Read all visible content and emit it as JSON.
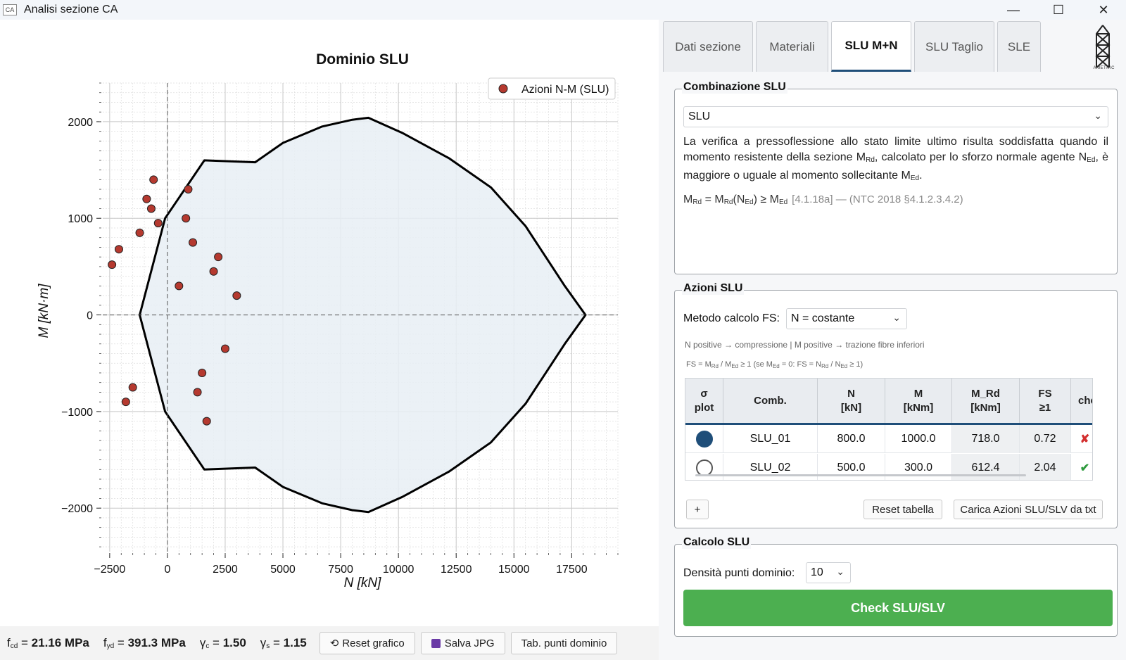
{
  "window": {
    "title": "Analisi sezione CA",
    "icon_label": "CA"
  },
  "plot": {
    "title": "Dominio SLU"
  },
  "chart_data": {
    "type": "scatter",
    "title": "Dominio SLU",
    "xlabel": "N [kN]",
    "ylabel": "M [kN·m]",
    "xlim": [
      -2800,
      19500
    ],
    "ylim": [
      -2450,
      2400
    ],
    "xticks": [
      -2500,
      0,
      2500,
      5000,
      7500,
      10000,
      12500,
      15000,
      17500
    ],
    "yticks": [
      -2000,
      -1000,
      0,
      1000,
      2000
    ],
    "grid": true,
    "legend": "top-right",
    "domain_boundary": [
      [
        -1200,
        0
      ],
      [
        -100,
        1000
      ],
      [
        1600,
        1600
      ],
      [
        3800,
        1580
      ],
      [
        5000,
        1780
      ],
      [
        6700,
        1950
      ],
      [
        8000,
        2020
      ],
      [
        8700,
        2040
      ],
      [
        10200,
        1880
      ],
      [
        12200,
        1620
      ],
      [
        14000,
        1320
      ],
      [
        15500,
        920
      ],
      [
        17200,
        300
      ],
      [
        18100,
        0
      ],
      [
        17200,
        -300
      ],
      [
        15500,
        -920
      ],
      [
        14000,
        -1320
      ],
      [
        12200,
        -1620
      ],
      [
        10200,
        -1880
      ],
      [
        8700,
        -2040
      ],
      [
        8000,
        -2020
      ],
      [
        6700,
        -1950
      ],
      [
        5000,
        -1780
      ],
      [
        3800,
        -1580
      ],
      [
        1600,
        -1600
      ],
      [
        -100,
        -1000
      ],
      [
        -1200,
        0
      ]
    ],
    "series": [
      {
        "name": "Azioni N-M (SLU)",
        "color": "#b5392f",
        "points": [
          [
            -600,
            1400
          ],
          [
            900,
            1300
          ],
          [
            -900,
            1200
          ],
          [
            -700,
            1100
          ],
          [
            800,
            1000
          ],
          [
            -400,
            950
          ],
          [
            -1200,
            850
          ],
          [
            1100,
            750
          ],
          [
            -2100,
            680
          ],
          [
            2200,
            600
          ],
          [
            -2400,
            520
          ],
          [
            2000,
            450
          ],
          [
            500,
            300
          ],
          [
            3000,
            200
          ],
          [
            2500,
            -350
          ],
          [
            1500,
            -600
          ],
          [
            -1500,
            -750
          ],
          [
            1300,
            -800
          ],
          [
            -1800,
            -900
          ],
          [
            1700,
            -1100
          ]
        ]
      }
    ]
  },
  "bottom_bar": {
    "fcd": "21.16 MPa",
    "fyd": "391.3 MPa",
    "gamma_c": "1.50",
    "gamma_s": "1.15",
    "reset_label": "Reset grafico",
    "save_label": "Salva JPG",
    "table_label": "Tab. punti dominio"
  },
  "tabs": [
    "Dati sezione",
    "Materiali",
    "SLU M+N",
    "SLU Taglio",
    "SLE"
  ],
  "logo_text": "AMETRIC",
  "combinazione": {
    "title": "Combinazione SLU",
    "selected": "SLU"
  },
  "azioni": {
    "title": "Azioni SLU",
    "metodo_label": "Metodo calcolo FS:",
    "metodo_value": "N = costante",
    "note1": "N positive → compressione  |  M positive → trazione fibre inferiori",
    "columns": [
      {
        "h1": "σ",
        "h2": "plot"
      },
      {
        "h1": "Comb.",
        "h2": ""
      },
      {
        "h1": "N",
        "h2": "[kN]"
      },
      {
        "h1": "M",
        "h2": "[kNm]"
      },
      {
        "h1": "M_Rd",
        "h2": "[kNm]"
      },
      {
        "h1": "FS",
        "h2": "≥1"
      },
      {
        "h1": "che",
        "h2": ""
      }
    ],
    "rows": [
      {
        "comb": "SLU_01",
        "N": "800.0",
        "M": "1000.0",
        "MRd": "718.0",
        "FS": "0.72",
        "check": "✘",
        "check_color": "#d32f2f",
        "selected": true
      },
      {
        "comb": "SLU_02",
        "N": "500.0",
        "M": "300.0",
        "MRd": "612.4",
        "FS": "2.04",
        "check": "✔",
        "check_color": "#2e9b3e",
        "selected": false
      }
    ],
    "add_label": "+",
    "reset_label": "Reset tabella",
    "load_label": "Carica Azioni SLU/SLV da txt"
  },
  "calcolo": {
    "title": "Calcolo SLU",
    "densita_label": "Densità punti dominio:",
    "densita_value": "10",
    "check_label": "Check SLU/SLV"
  }
}
